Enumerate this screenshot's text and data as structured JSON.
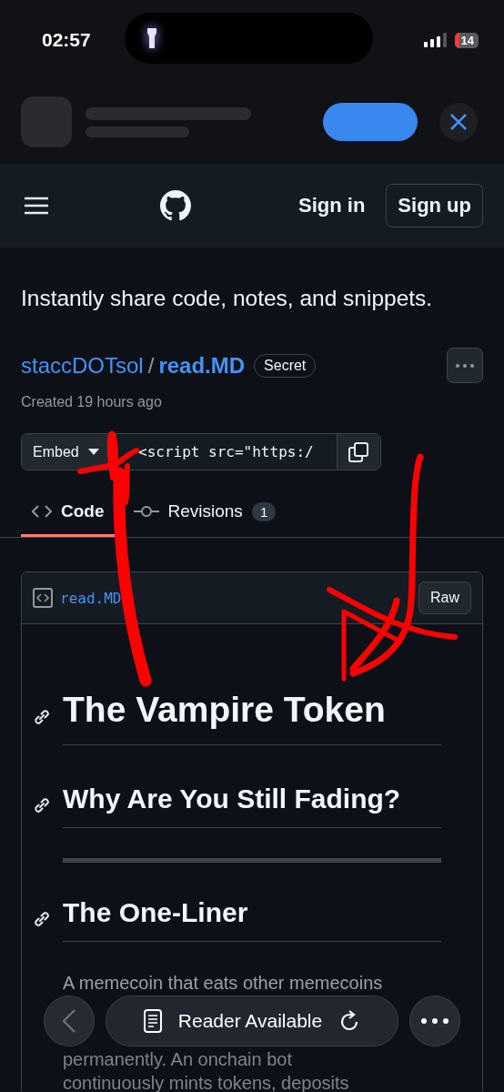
{
  "status_bar": {
    "time": "02:57",
    "battery": "14"
  },
  "header": {
    "sign_in": "Sign in",
    "sign_up": "Sign up"
  },
  "tagline": "Instantly share code, notes, and snippets.",
  "gist": {
    "owner": "staccDOTsol",
    "separator": "/",
    "name": "read.MD",
    "badge": "Secret",
    "created": "Created 19 hours ago"
  },
  "embed": {
    "label": "Embed",
    "code": "<script src=\"https:/"
  },
  "tabs": [
    {
      "label": "Code",
      "selected": true
    },
    {
      "label": "Revisions",
      "count": "1",
      "selected": false
    }
  ],
  "file": {
    "name": "read.MD",
    "raw": "Raw"
  },
  "content": [
    {
      "kind": "h1",
      "text": "The Vampire Token"
    },
    {
      "kind": "h2",
      "text": "Why Are You Still Fading?"
    },
    {
      "kind": "hr"
    },
    {
      "kind": "h2",
      "text": "The One-Liner"
    },
    {
      "kind": "p",
      "lines": [
        "A memecoin that eats other memecoins",
        "permanently. An onchain bot",
        "continuously mints tokens, deposits"
      ]
    }
  ],
  "bottom_bar": {
    "reader": "Reader Available"
  }
}
